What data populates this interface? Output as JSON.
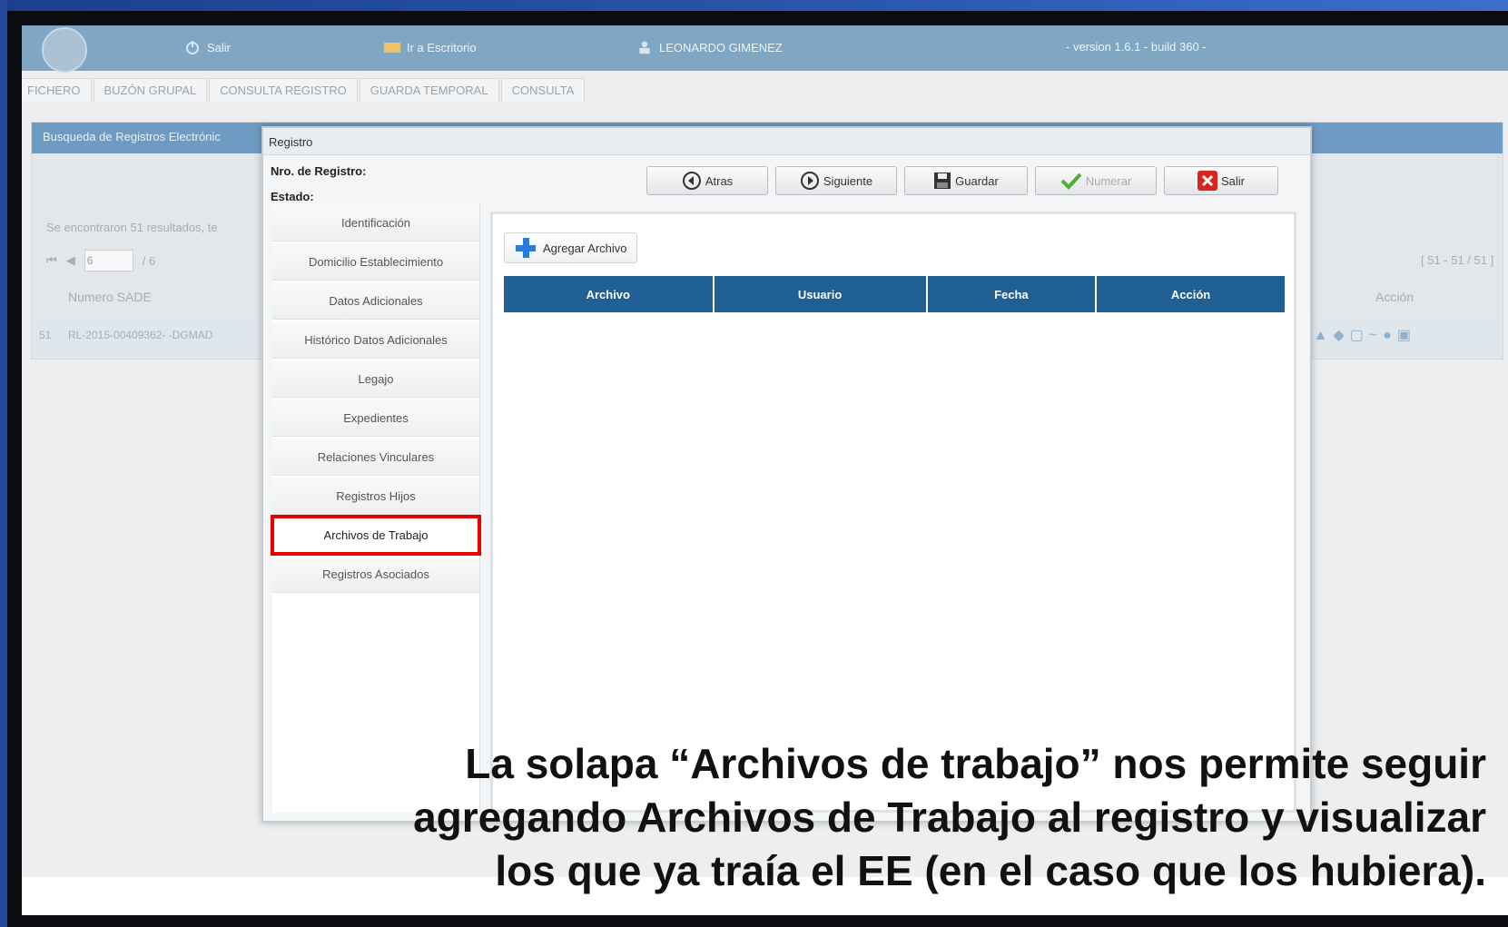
{
  "topbar": {
    "salir": "Salir",
    "escritorio": "Ir a Escritorio",
    "user": "LEONARDO GIMENEZ",
    "version": "- version 1.6.1 - build 360 -"
  },
  "tabs": [
    "FICHERO",
    "BUZÓN GRUPAL",
    "CONSULTA REGISTRO",
    "GUARDA TEMPORAL",
    "CONSULTA"
  ],
  "background": {
    "panel_title": "Busqueda de Registros Electrónic",
    "results": "Se encontraron 51 resultados, te",
    "page_input": "6",
    "page_total": "/ 6",
    "range": "[ 51 - 51 / 51 ]",
    "col_numero": "Numero SADE",
    "col_accion": "Acción",
    "row_num": "51",
    "row_value": "RL-2015-00409362- -DGMAD"
  },
  "dialog": {
    "title": "Registro",
    "nro_label": "Nro. de Registro:",
    "estado_label": "Estado:",
    "buttons": {
      "atras": "Atras",
      "siguiente": "Siguiente",
      "guardar": "Guardar",
      "numerar": "Numerar",
      "salir": "Salir"
    },
    "nav": [
      "Identificación",
      "Domicilio Establecimiento",
      "Datos Adicionales",
      "Histórico Datos Adicionales",
      "Legajo",
      "Expedientes",
      "Relaciones Vinculares",
      "Registros Hijos",
      "Archivos de Trabajo",
      "Registros Asociados"
    ],
    "active_nav": "Archivos de Trabajo",
    "add_button": "Agregar Archivo",
    "columns": [
      "Archivo",
      "Usuario",
      "Fecha",
      "Acción"
    ]
  },
  "caption": {
    "line1": "La solapa “Archivos de trabajo” nos permite seguir",
    "line2": "agregando Archivos de Trabajo al registro y visualizar",
    "line3": "los que ya traía el EE (en el caso que los hubiera)."
  },
  "colors": {
    "topbar": "#7fa6c2",
    "grid_header": "#1f5f94",
    "highlight": "#e60000"
  }
}
